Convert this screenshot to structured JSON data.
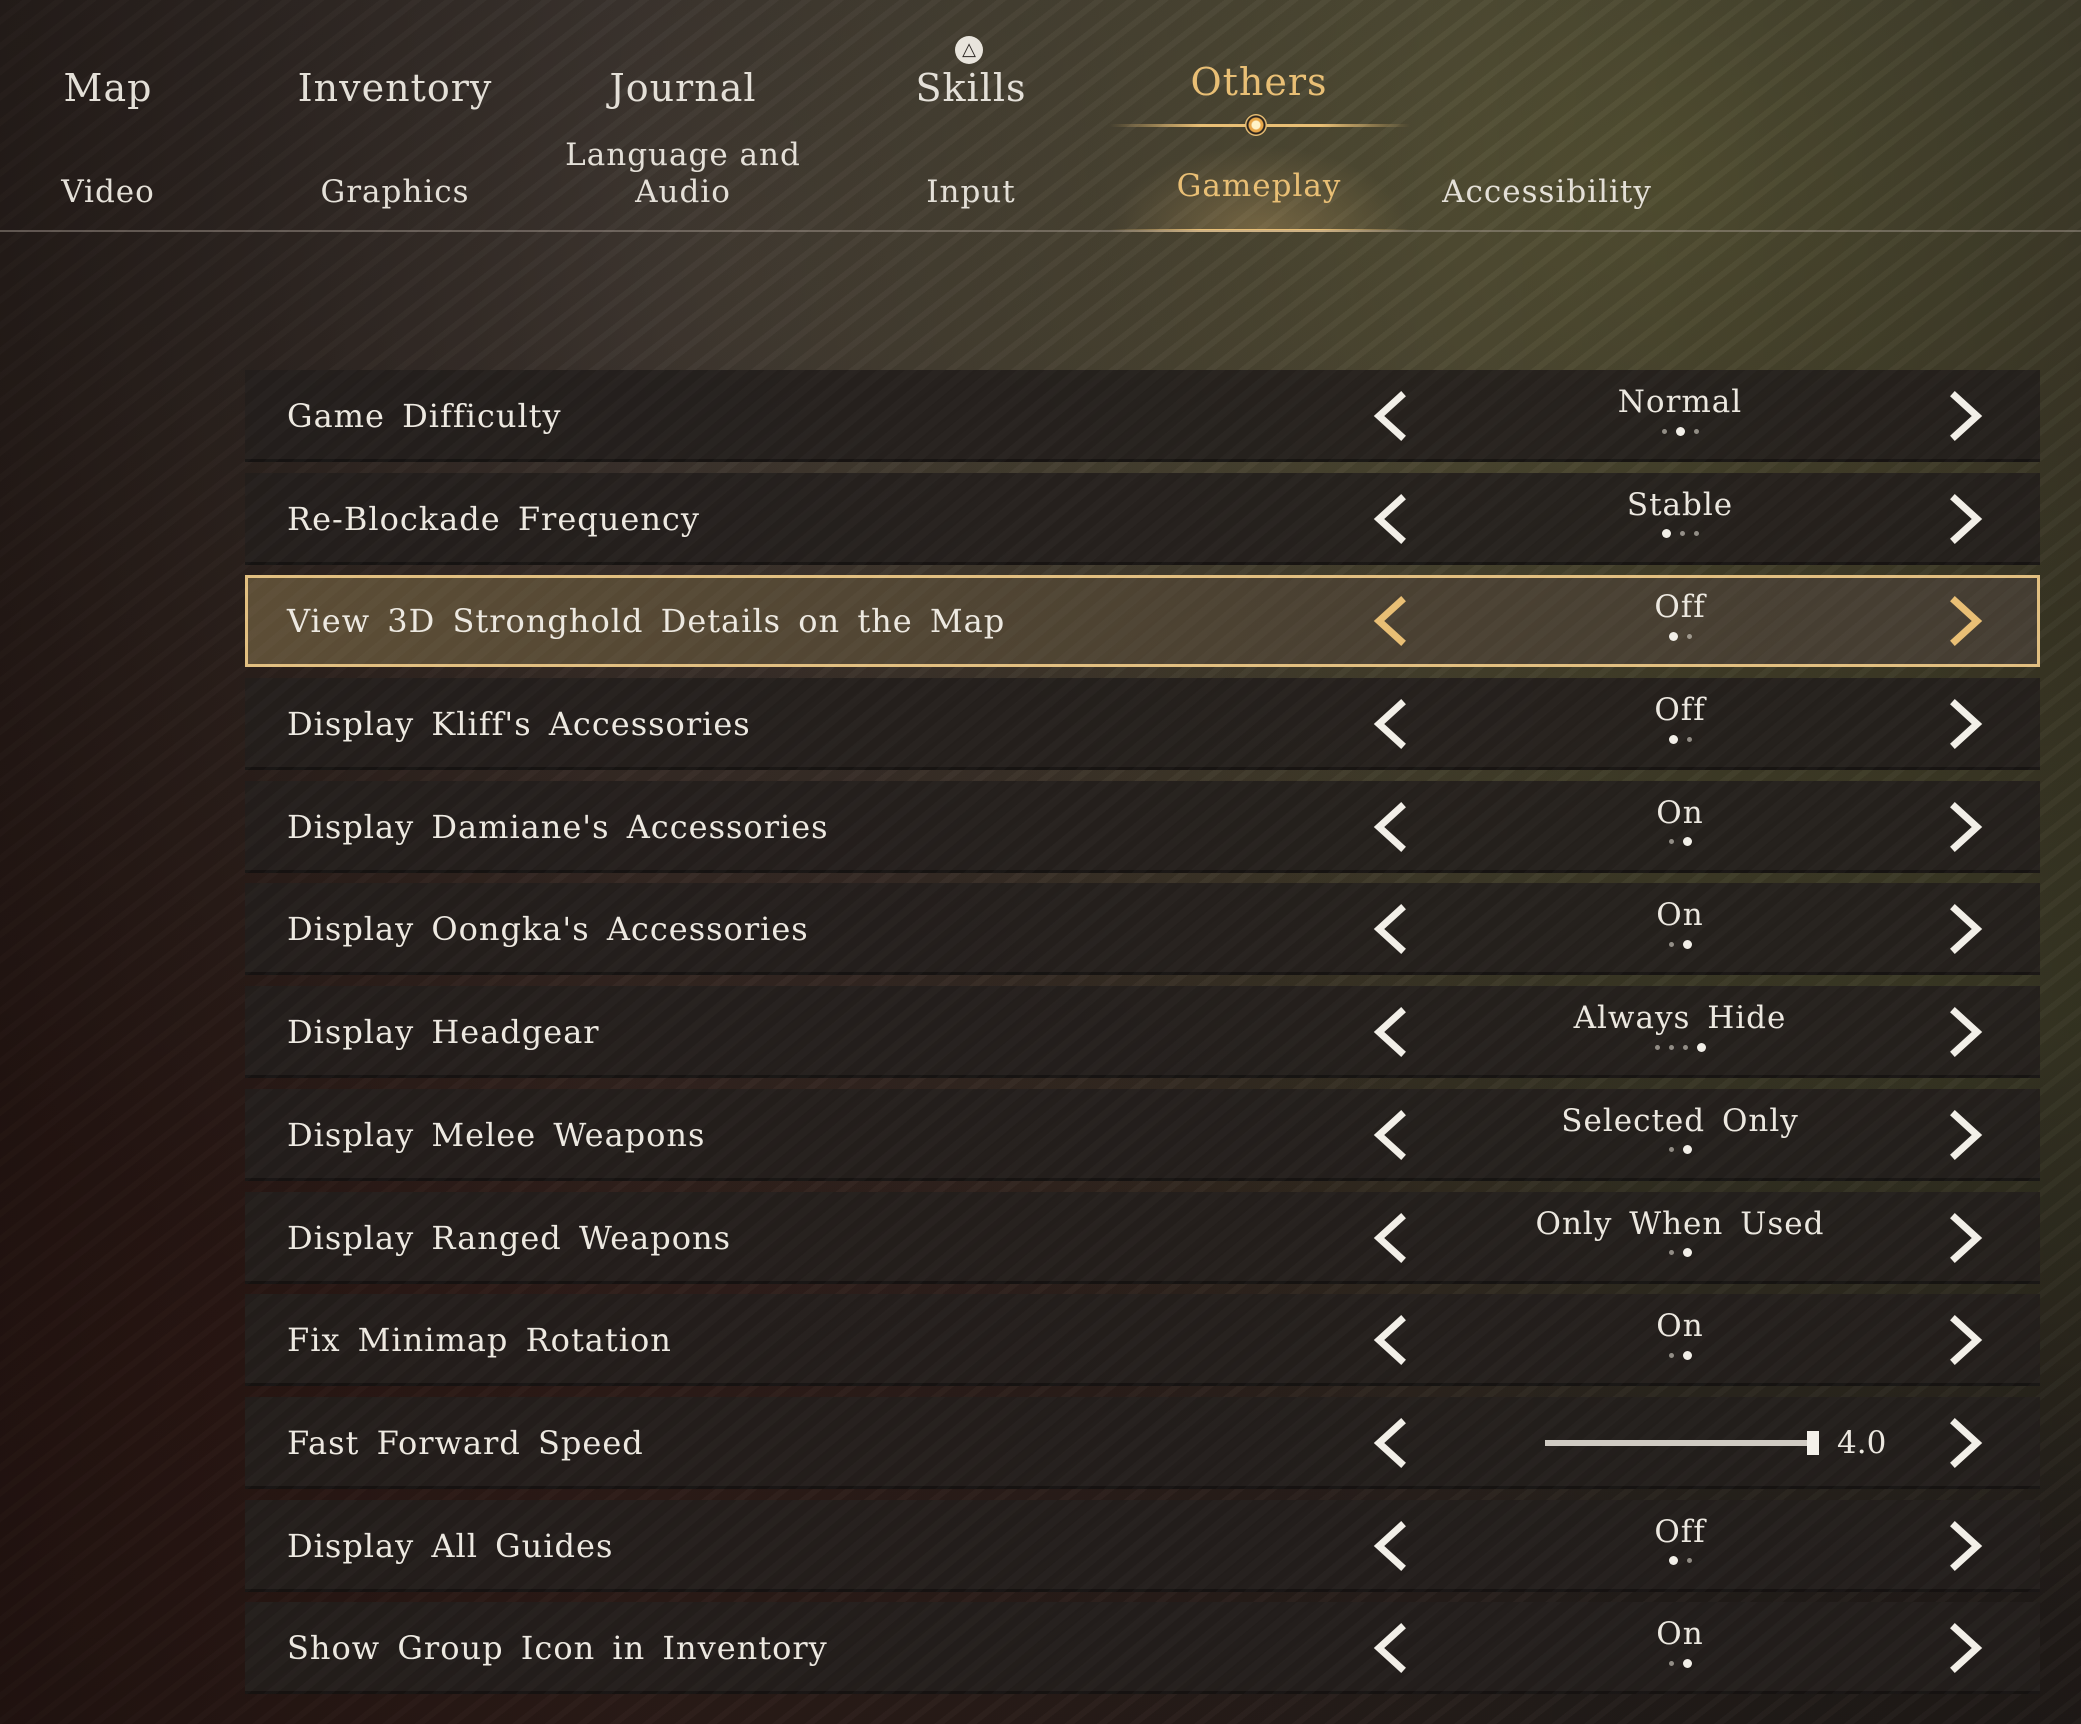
{
  "top_tabs": [
    {
      "label": "Map"
    },
    {
      "label": "Inventory"
    },
    {
      "label": "Journal"
    },
    {
      "label": "Skills"
    },
    {
      "label": "Others"
    }
  ],
  "top_tabs_active": "Others",
  "sub_tabs": [
    {
      "label": "Video"
    },
    {
      "label": "Graphics"
    },
    {
      "label_line1": "Language and",
      "label_line2": "Audio"
    },
    {
      "label": "Input"
    },
    {
      "label": "Gameplay"
    },
    {
      "label": "Accessibility"
    }
  ],
  "sub_tabs_active": "Gameplay",
  "colors": {
    "accent": "#e9bf75",
    "selected_border": "#e2bf80",
    "row_bg": "#221e1c",
    "text": "#ede9e1"
  },
  "icons": {
    "skills": "skills-badge-icon",
    "arrow_left": "chevron-left-icon",
    "arrow_right": "chevron-right-icon"
  },
  "settings": [
    {
      "label": "Game Difficulty",
      "value": "Normal",
      "option_count": 3,
      "option_index": 1
    },
    {
      "label": "Re-Blockade Frequency",
      "value": "Stable",
      "option_count": 3,
      "option_index": 0
    },
    {
      "label": "View 3D Stronghold Details on the Map",
      "value": "Off",
      "option_count": 2,
      "option_index": 0,
      "selected": true
    },
    {
      "label": "Display Kliff's Accessories",
      "value": "Off",
      "option_count": 2,
      "option_index": 0
    },
    {
      "label": "Display Damiane's Accessories",
      "value": "On",
      "option_count": 2,
      "option_index": 1
    },
    {
      "label": "Display Oongka's Accessories",
      "value": "On",
      "option_count": 2,
      "option_index": 1
    },
    {
      "label": "Display Headgear",
      "value": "Always Hide",
      "option_count": 4,
      "option_index": 3
    },
    {
      "label": "Display Melee Weapons",
      "value": "Selected Only",
      "option_count": 2,
      "option_index": 1
    },
    {
      "label": "Display Ranged Weapons",
      "value": "Only When Used",
      "option_count": 2,
      "option_index": 1
    },
    {
      "label": "Fix Minimap Rotation",
      "value": "On",
      "option_count": 2,
      "option_index": 1
    },
    {
      "label": "Fast Forward Speed",
      "type": "slider",
      "value": "4.0",
      "slider_fraction": 1.0
    },
    {
      "label": "Display All Guides",
      "value": "Off",
      "option_count": 2,
      "option_index": 0
    },
    {
      "label": "Show Group Icon in Inventory",
      "value": "On",
      "option_count": 2,
      "option_index": 1
    }
  ]
}
